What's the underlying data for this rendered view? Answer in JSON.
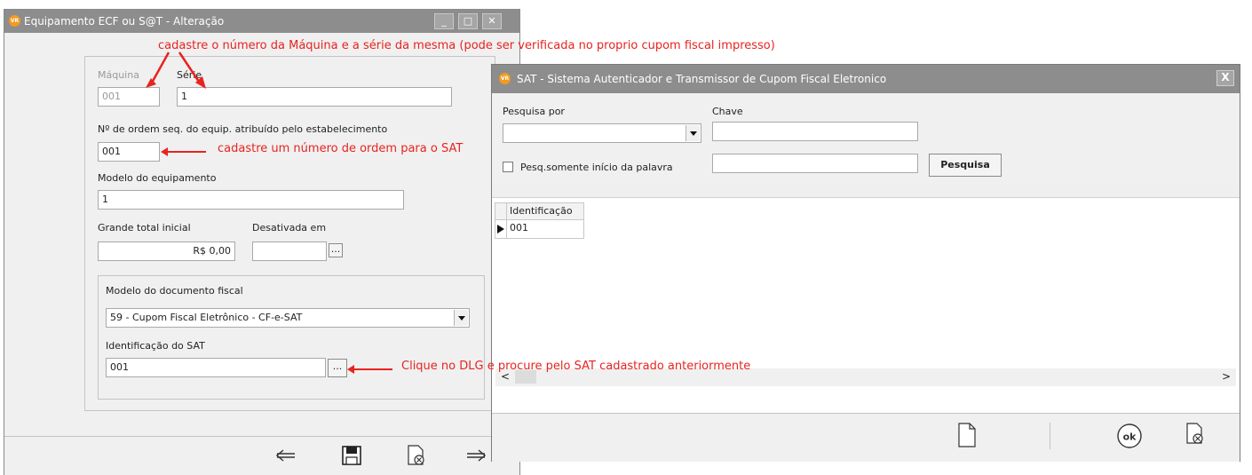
{
  "colors": {
    "titlebar": "#8d8d8d",
    "annotation": "#e8231f",
    "app_icon": "#f39a1f"
  },
  "window1": {
    "title": "Equipamento ECF ou S@T - Alteração",
    "app_icon_text": "VR",
    "maquina": {
      "label": "Máquina",
      "value": "001"
    },
    "serie": {
      "label": "Série",
      "value": "1"
    },
    "ordem": {
      "label": "Nº de ordem seq. do equip. atribuído pelo estabelecimento",
      "value": "001"
    },
    "modelo_equip": {
      "label": "Modelo do equipamento",
      "value": "1"
    },
    "grande_total": {
      "label": "Grande total inicial",
      "value": "R$ 0,00"
    },
    "desativada": {
      "label": "Desativada em",
      "value": ""
    },
    "modelo_doc": {
      "label": "Modelo do documento fiscal",
      "value": "59 - Cupom Fiscal Eletrônico - CF-e-SAT"
    },
    "identificacao_sat": {
      "label": "Identificação do SAT",
      "value": "001"
    },
    "dots": "..."
  },
  "window2": {
    "title": "SAT - Sistema Autenticador e Transmissor de Cupom Fiscal Eletronico",
    "close": "X",
    "pesquisa_por": {
      "label": "Pesquisa por",
      "value": ""
    },
    "chave": {
      "label": "Chave",
      "value": ""
    },
    "checkbox_label": "Pesq.somente início da palavra",
    "pesquisa_button": "Pesquisa",
    "grid": {
      "header": "Identificação",
      "rows": [
        "001"
      ]
    },
    "scroll_left": "<",
    "scroll_right": ">"
  },
  "annotations": {
    "a1": "cadastre o número da Máquina e a série da mesma (pode ser verificada no proprio cupom fiscal impresso)",
    "a2": "cadastre um número de ordem para o SAT",
    "a3": "Clique no DLG e procure pelo SAT cadastrado anteriormente"
  }
}
